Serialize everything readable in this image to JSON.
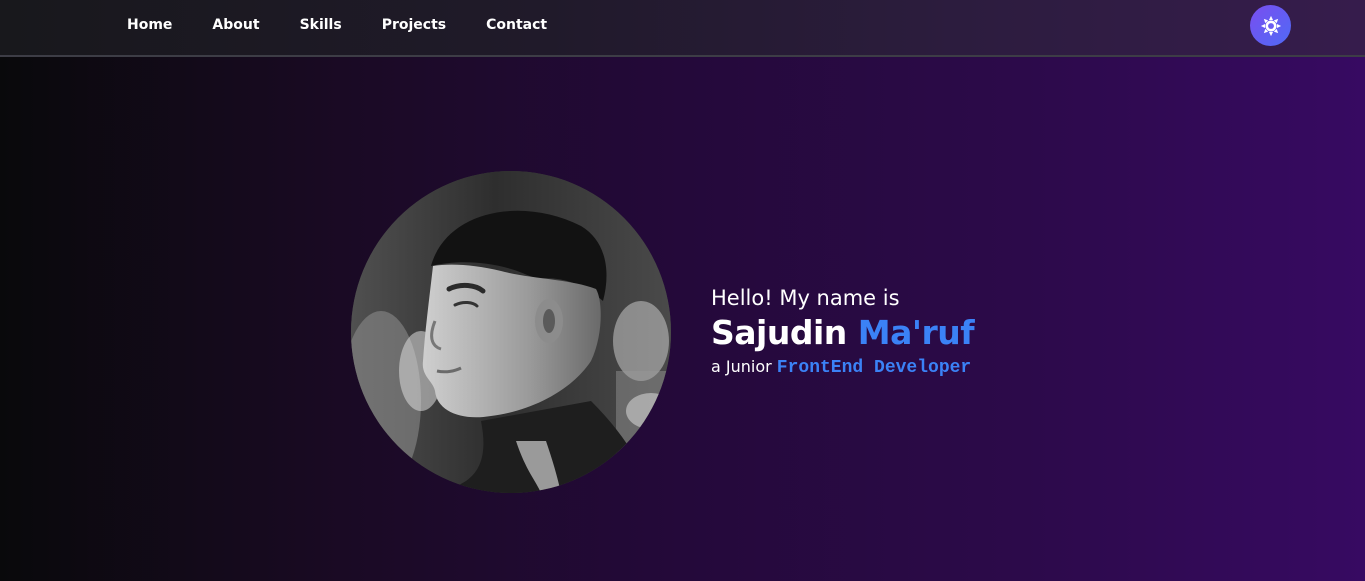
{
  "nav": {
    "items": [
      {
        "label": "Home"
      },
      {
        "label": "About"
      },
      {
        "label": "Skills"
      },
      {
        "label": "Projects"
      },
      {
        "label": "Contact"
      }
    ],
    "theme_toggle_icon": "sun-gear-icon"
  },
  "hero": {
    "avatar_icon": "profile-photo",
    "greeting": "Hello! My name is",
    "first_name": "Sajudin",
    "last_name": "Ma'ruf",
    "role_prefix": "a Junior",
    "role_title": "FrontEnd Developer"
  },
  "colors": {
    "accent": "#3b82f6",
    "toggle_start": "#7a4ef0",
    "toggle_end": "#4f6af5",
    "background_start": "#09090b",
    "background_end": "#370a62"
  }
}
